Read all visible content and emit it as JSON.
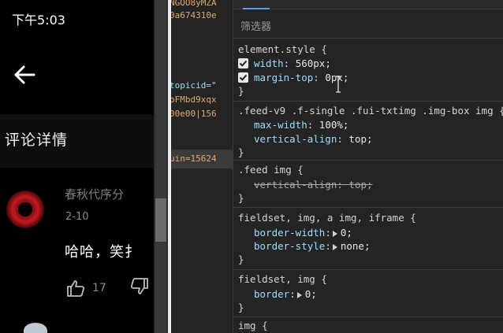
{
  "phone": {
    "status_time": "下午5:03",
    "section_title": "评论详情",
    "comment": {
      "author": "春秋代序分",
      "date": "2-10",
      "text": "哈哈，笑扌",
      "like_count": "17"
    },
    "icons": [
      "back-arrow-icon",
      "thumbs-up-icon",
      "thumbs-down-icon"
    ]
  },
  "dom": {
    "lines": [
      "NGOO8yMZA",
      "0a674310e",
      "topicid=\"",
      "oFMbd9xqx",
      "00e00|156",
      "uin=15624"
    ]
  },
  "styles": {
    "filter_placeholder": "筛选器",
    "rules": [
      {
        "selector": "element.style {",
        "props": [
          {
            "name": "width",
            "value": "560px;"
          },
          {
            "name": "margin-top",
            "value": "0px;"
          }
        ]
      },
      {
        "selector": ".feed-v9 .f-single .fui-txtimg .img-box img {",
        "props": [
          {
            "name": "max-width",
            "value": "100%;"
          },
          {
            "name": "vertical-align",
            "value": "top;"
          }
        ]
      },
      {
        "selector": ".feed img {",
        "props": [
          {
            "name": "vertical-align",
            "value": "top;"
          }
        ]
      },
      {
        "selector": "fieldset, img, a img, iframe {",
        "props": [
          {
            "name": "border-width",
            "value": "0;"
          },
          {
            "name": "border-style",
            "value": "none;"
          }
        ]
      },
      {
        "selector": "fieldset, img {",
        "props": [
          {
            "name": "border",
            "value": "0;"
          }
        ]
      },
      {
        "selector": "img {",
        "props": []
      }
    ],
    "close_brace": "}",
    "colon": ": "
  },
  "colors": {
    "property_name": "#9cdcfe",
    "accent_tab": "#5c9ee6",
    "background": "#242424"
  }
}
